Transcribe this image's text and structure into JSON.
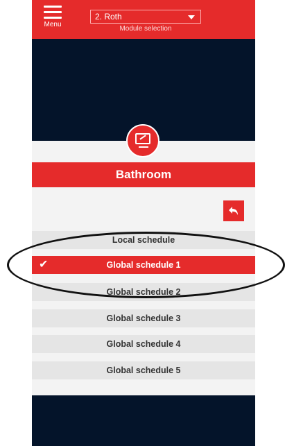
{
  "header": {
    "menu_label": "Menu",
    "module_value": "2. Roth",
    "module_caption": "Module selection"
  },
  "room": {
    "name": "Bathroom",
    "icon": "monitor-icon"
  },
  "schedules": [
    {
      "label": "Local schedule",
      "selected": false
    },
    {
      "label": "Global schedule 1",
      "selected": true
    },
    {
      "label": "Global schedule 2",
      "selected": false
    },
    {
      "label": "Global schedule 3",
      "selected": false
    },
    {
      "label": "Global schedule 4",
      "selected": false
    },
    {
      "label": "Global schedule 5",
      "selected": false
    }
  ],
  "colors": {
    "accent": "#e52b2b",
    "background": "#04142a",
    "panel": "#f3f3f3",
    "row": "#e5e5e5"
  }
}
